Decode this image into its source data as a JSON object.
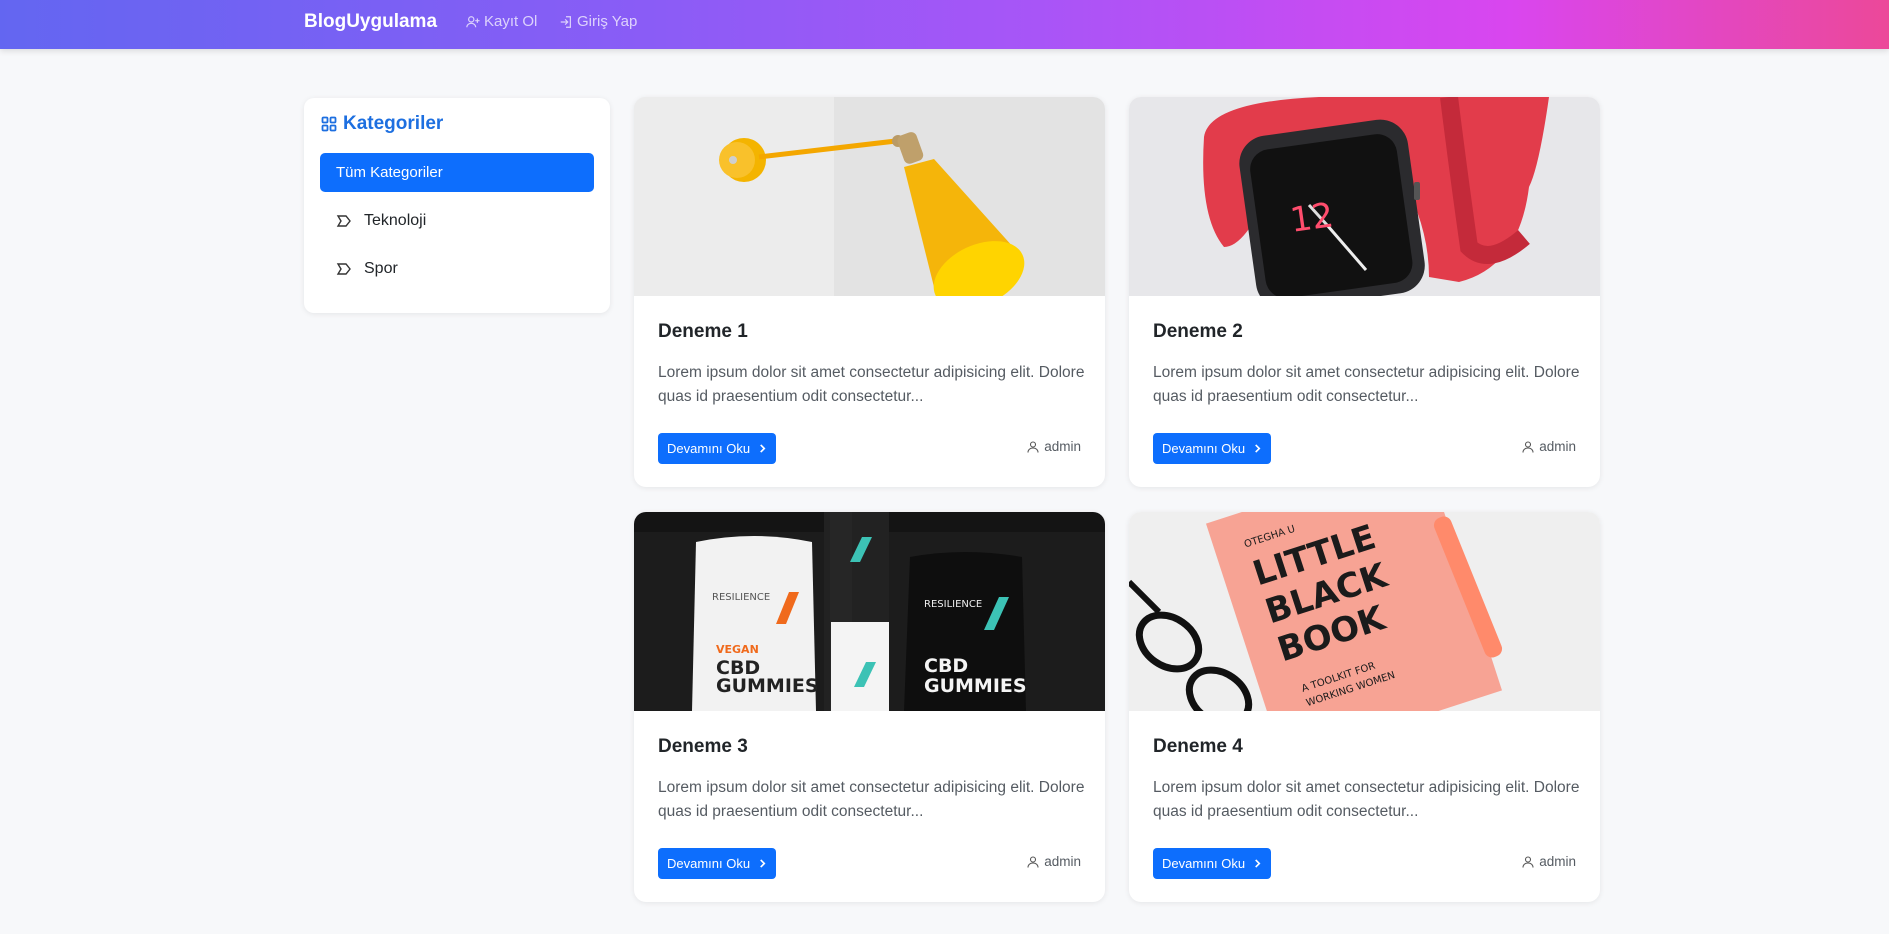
{
  "navbar": {
    "brand": "BlogUygulama",
    "register_label": "Kayıt Ol",
    "login_label": "Giriş Yap"
  },
  "sidebar": {
    "title": "Kategoriler",
    "items": [
      {
        "label": "Tüm Kategoriler",
        "active": true
      },
      {
        "label": "Teknoloji",
        "active": false
      },
      {
        "label": "Spor",
        "active": false
      }
    ]
  },
  "posts": [
    {
      "title": "Deneme 1",
      "excerpt": "Lorem ipsum dolor sit amet consectetur adipisicing elit. Dolore quas id praesentium odit consectetur...",
      "button": "Devamını Oku",
      "author": "admin",
      "image": "yellow-wall-lamp"
    },
    {
      "title": "Deneme 2",
      "excerpt": "Lorem ipsum dolor sit amet consectetur adipisicing elit. Dolore quas id praesentium odit consectetur...",
      "button": "Devamını Oku",
      "author": "admin",
      "image": "red-smartwatch"
    },
    {
      "title": "Deneme 3",
      "excerpt": "Lorem ipsum dolor sit amet consectetur adipisicing elit. Dolore quas id praesentium odit consectetur...",
      "button": "Devamını Oku",
      "author": "admin",
      "image": "cbd-gummies-packages"
    },
    {
      "title": "Deneme 4",
      "excerpt": "Lorem ipsum dolor sit amet consectetur adipisicing elit. Dolore quas id praesentium odit consectetur...",
      "button": "Devamını Oku",
      "author": "admin",
      "image": "pink-book-and-glasses"
    }
  ],
  "images": {
    "post3": {
      "brand1": "RESILIENCE",
      "vegan": "VEGAN",
      "cbd": "CBD",
      "gummies": "GUMMIES",
      "brand2": "RESILIENCE"
    },
    "post4": {
      "author_line": "OTEGHA U",
      "line1": "LITTLE",
      "line2": "BLACK",
      "line3": "BOOK",
      "sub1": "A TOOLKIT FOR",
      "sub2": "WORKING WOMEN"
    }
  },
  "colors": {
    "primary": "#0d6efd",
    "accent_title": "#1d6fe0",
    "nav_gradient_start": "#6366f1",
    "nav_gradient_end": "#ec4899"
  }
}
